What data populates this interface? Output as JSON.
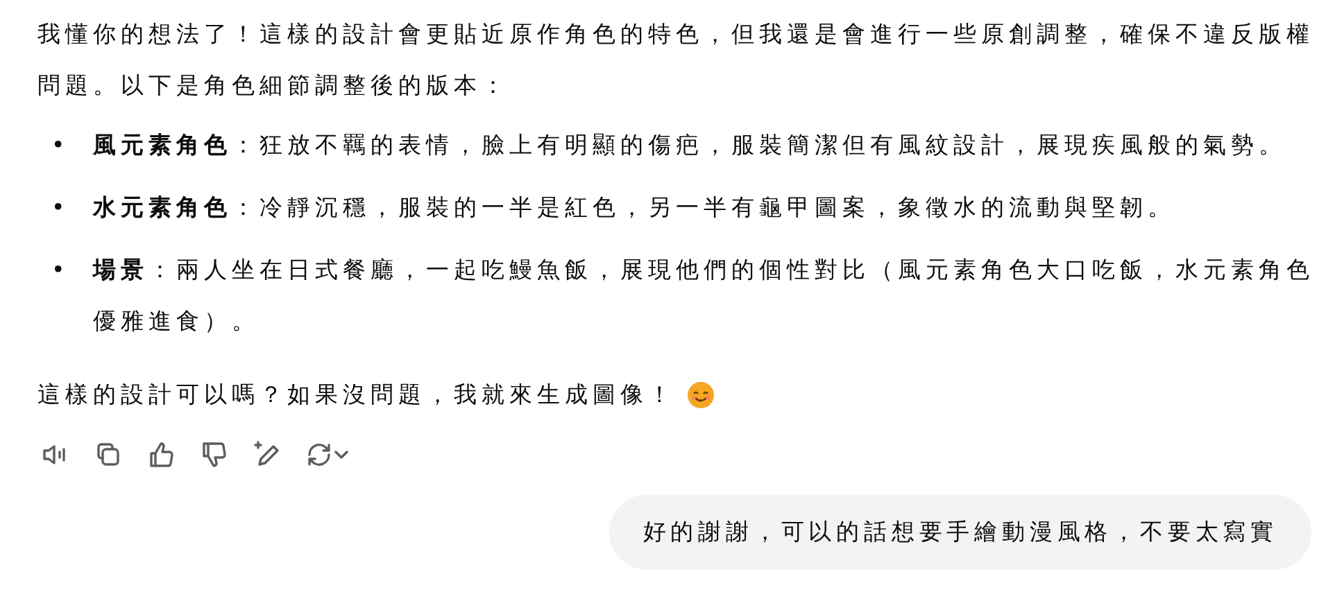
{
  "assistant_message": {
    "intro": "我懂你的想法了！這樣的設計會更貼近原作角色的特色，但我還是會進行一些原創調整，確保不違反版權問題。以下是角色細節調整後的版本：",
    "items": [
      {
        "marker": "•",
        "text": "**風元素角色**：狂放不羈的表情，臉上有明顯的傷疤，服裝簡潔但有風紋設計，展現疾風般的氣勢。"
      },
      {
        "marker": "•",
        "text": "**水元素角色**：冷靜沉穩，服裝的一半是紅色，另一半有龜甲圖案，象徵水的流動與堅韌。"
      },
      {
        "marker": "•",
        "text": "**場景**：兩人坐在日式餐廳，一起吃鰻魚飯，展現他們的個性對比（風元素角色大口吃飯，水元素角色優雅進食）。"
      }
    ],
    "closing": "這樣的設計可以嗎？如果沒問題，我就來生成圖像！"
  },
  "user_message": {
    "text": "好的謝謝，可以的話想要手繪動漫風格，不要太寫實"
  }
}
